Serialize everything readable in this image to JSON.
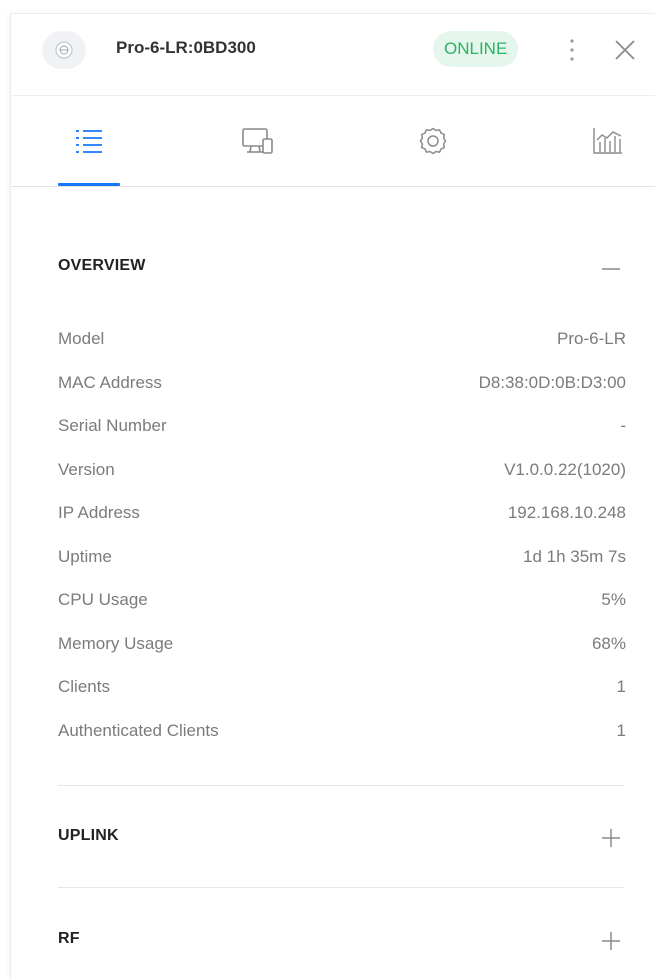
{
  "header": {
    "device_name": "Pro-6-LR:0BD300",
    "status": "ONLINE",
    "device_icon": "access-point-icon",
    "more_icon": "more-vertical-icon",
    "close_icon": "close-icon"
  },
  "tabs": [
    {
      "name": "overview",
      "icon": "list-icon",
      "active": true
    },
    {
      "name": "devices",
      "icon": "monitor-device-icon",
      "active": false
    },
    {
      "name": "settings",
      "icon": "gear-icon",
      "active": false
    },
    {
      "name": "statistics",
      "icon": "bar-chart-icon",
      "active": false
    }
  ],
  "overview": {
    "title": "OVERVIEW",
    "toggle": "—",
    "rows": [
      {
        "label": "Model",
        "value": "Pro-6-LR"
      },
      {
        "label": "MAC Address",
        "value": "D8:38:0D:0B:D3:00"
      },
      {
        "label": "Serial Number",
        "value": "-"
      },
      {
        "label": "Version",
        "value": "V1.0.0.22(1020)"
      },
      {
        "label": "IP Address",
        "value": "192.168.10.248"
      },
      {
        "label": "Uptime",
        "value": "1d 1h 35m 7s"
      },
      {
        "label": "CPU Usage",
        "value": "5%"
      },
      {
        "label": "Memory Usage",
        "value": "68%"
      },
      {
        "label": "Clients",
        "value": "1"
      },
      {
        "label": "Authenticated Clients",
        "value": "1"
      }
    ]
  },
  "uplink": {
    "title": "UPLINK",
    "toggle": "+"
  },
  "rf": {
    "title": "RF",
    "toggle": "+"
  },
  "colors": {
    "accent": "#1677ff",
    "online_text": "#28b463",
    "online_bg": "#e5f6ec",
    "label": "#7b7b7b"
  }
}
